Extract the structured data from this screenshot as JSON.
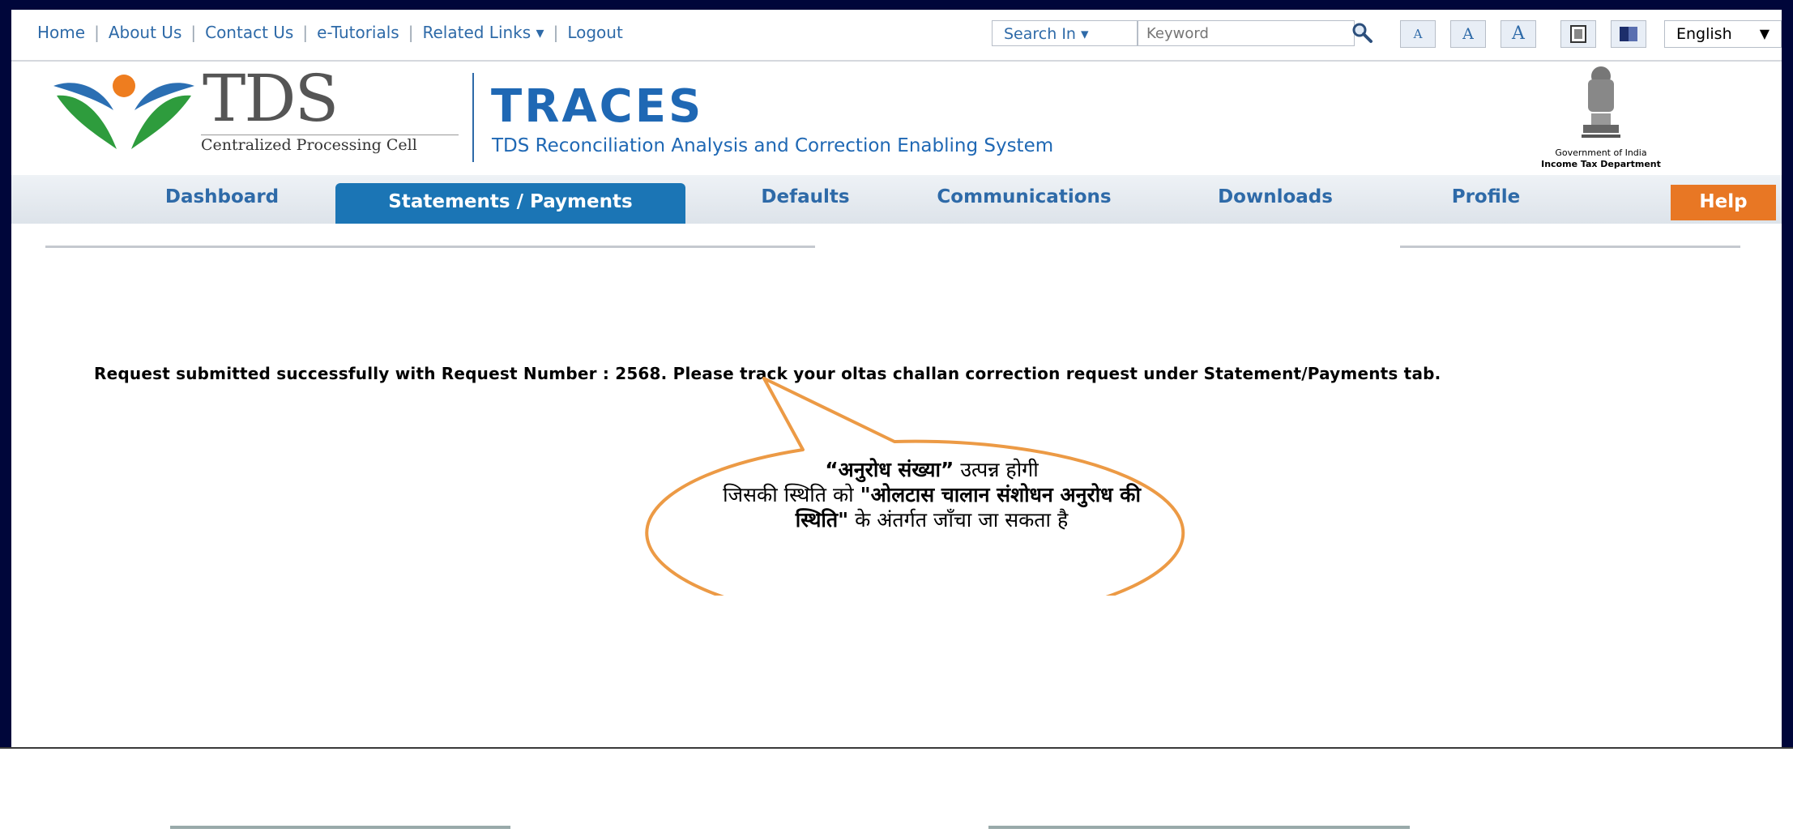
{
  "top_links": [
    "Home",
    "About Us",
    "Contact Us",
    "e-Tutorials",
    "Related Links ▾",
    "Logout"
  ],
  "search": {
    "scope_label": "Search In ▾",
    "placeholder": "Keyword"
  },
  "font_buttons": [
    "A",
    "A",
    "A"
  ],
  "language": {
    "selected": "English",
    "arrow": "▼"
  },
  "logo": {
    "word": "TDS",
    "tagline": "Centralized Processing Cell"
  },
  "traces": {
    "title": "TRACES",
    "subtitle": "TDS Reconciliation Analysis and Correction Enabling System"
  },
  "emblem": {
    "line1": "Government of India",
    "line2": "Income Tax Department"
  },
  "nav": {
    "dashboard": "Dashboard",
    "statements": "Statements / Payments",
    "defaults": "Defaults",
    "communications": "Communications",
    "downloads": "Downloads",
    "profile": "Profile",
    "help": "Help"
  },
  "message": "Request submitted successfully with Request Number : 2568. Please track your oltas challan correction request under Statement/Payments tab.",
  "callout": {
    "bold_1": "“अनुरोध संख्या”",
    "text_1": " उत्पन्न होगी",
    "text_2": "जिसकी स्थिति को ",
    "bold_2": "\"ओलटास चालान संशोधन अनुरोध की स्थिति\"",
    "text_3": " के अंतर्गत जाँचा जा सकता है"
  },
  "colors": {
    "frame": "#00063a",
    "link_blue": "#2e6aa8",
    "traces_blue": "#1f68b4",
    "nav_active": "#1b75b5",
    "help_orange": "#e87724",
    "callout_border": "#ec9a45"
  }
}
